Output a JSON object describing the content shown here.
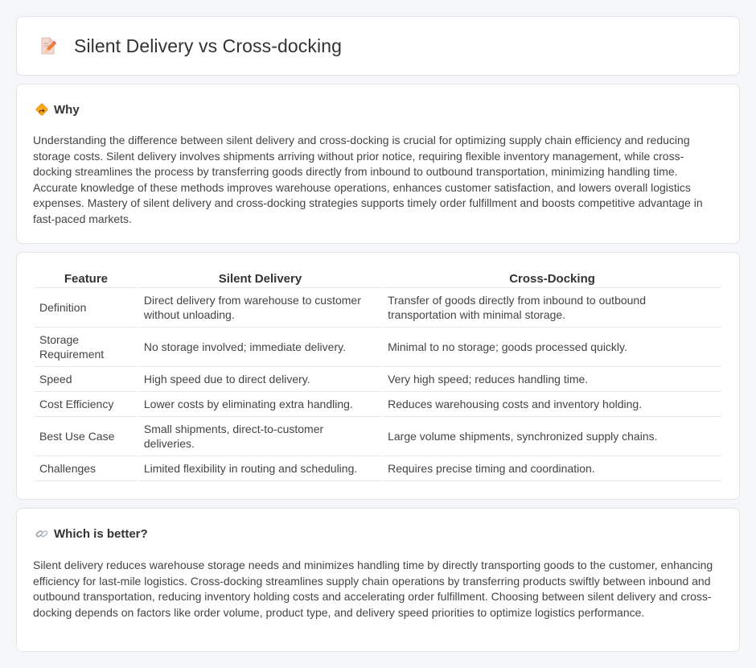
{
  "page": {
    "title": "Silent Delivery vs Cross-docking",
    "title_icon": "document-pencil-icon"
  },
  "why": {
    "icon": "diamond-sign-icon",
    "heading": "Why",
    "text": "Understanding the difference between silent delivery and cross-docking is crucial for optimizing supply chain efficiency and reducing storage costs. Silent delivery involves shipments arriving without prior notice, requiring flexible inventory management, while cross-docking streamlines the process by transferring goods directly from inbound to outbound transportation, minimizing handling time. Accurate knowledge of these methods improves warehouse operations, enhances customer satisfaction, and lowers overall logistics expenses. Mastery of silent delivery and cross-docking strategies supports timely order fulfillment and boosts competitive advantage in fast-paced markets."
  },
  "comparison": {
    "headers": [
      "Feature",
      "Silent Delivery",
      "Cross-Docking"
    ],
    "rows": [
      [
        "Definition",
        "Direct delivery from warehouse to customer without unloading.",
        "Transfer of goods directly from inbound to outbound transportation with minimal storage."
      ],
      [
        "Storage Requirement",
        "No storage involved; immediate delivery.",
        "Minimal to no storage; goods processed quickly."
      ],
      [
        "Speed",
        "High speed due to direct delivery.",
        "Very high speed; reduces handling time."
      ],
      [
        "Cost Efficiency",
        "Lower costs by eliminating extra handling.",
        "Reduces warehousing costs and inventory holding."
      ],
      [
        "Best Use Case",
        "Small shipments, direct-to-customer deliveries.",
        "Large volume shipments, synchronized supply chains."
      ],
      [
        "Challenges",
        "Limited flexibility in routing and scheduling.",
        "Requires precise timing and coordination."
      ]
    ]
  },
  "better": {
    "icon": "link-icon",
    "heading": "Which is better?",
    "text": "Silent delivery reduces warehouse storage needs and minimizes handling time by directly transporting goods to the customer, enhancing efficiency for last-mile logistics. Cross-docking streamlines supply chain operations by transferring products swiftly between inbound and outbound transportation, reducing inventory holding costs and accelerating order fulfillment. Choosing between silent delivery and cross-docking depends on factors like order volume, product type, and delivery speed priorities to optimize logistics performance."
  }
}
